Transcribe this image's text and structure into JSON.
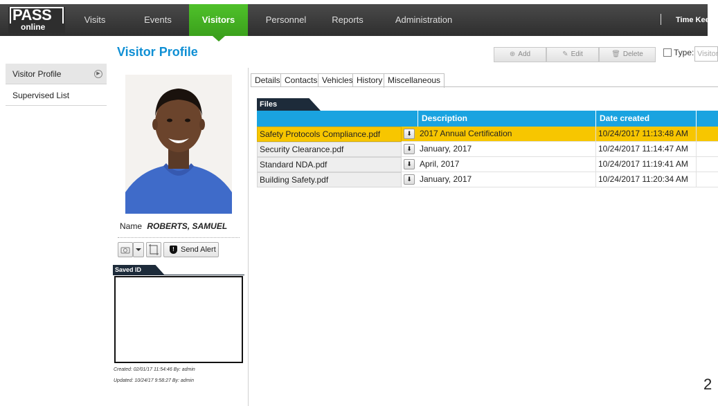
{
  "header": {
    "logo_main": "PASS",
    "logo_sub": "online",
    "nav": [
      "Visits",
      "Events",
      "Visitors",
      "Personnel",
      "Reports",
      "Administration"
    ],
    "active_nav": "Visitors",
    "right_item": "Time Keeping"
  },
  "sidebar": {
    "items": [
      {
        "label": "Visitor Profile"
      },
      {
        "label": "Supervised List"
      }
    ]
  },
  "page": {
    "title": "Visitor Profile"
  },
  "toolbar": {
    "add_label": "Add",
    "edit_label": "Edit",
    "delete_label": "Delete",
    "type_label": "Type:",
    "type_placeholder": "Visitor"
  },
  "profile": {
    "name_label": "Name",
    "name_value": "ROBERTS, SAMUEL",
    "send_alert": "Send Alert",
    "saved_id_label": "Saved ID",
    "created": "Created:  02/01/17 11:54:46  By: admin",
    "updated": "Updated:  10/24/17 9:58:27  By: admin"
  },
  "tabs": [
    "Details",
    "Contacts",
    "Vehicles",
    "History",
    "Miscellaneous"
  ],
  "active_tab": "Miscellaneous",
  "files": {
    "section_label": "Files",
    "columns": [
      "",
      "Description",
      "Date created"
    ],
    "rows": [
      {
        "file": "Safety Protocols Compliance.pdf",
        "description": "2017 Annual Certification",
        "date": "10/24/2017 11:13:48 AM",
        "selected": true
      },
      {
        "file": "Security Clearance.pdf",
        "description": "January, 2017",
        "date": "10/24/2017 11:14:47 AM",
        "selected": false
      },
      {
        "file": "Standard NDA.pdf",
        "description": "April, 2017",
        "date": "10/24/2017 11:19:41 AM",
        "selected": false
      },
      {
        "file": "Building Safety.pdf",
        "description": "January, 2017",
        "date": "10/24/2017 11:20:34 AM",
        "selected": false
      }
    ]
  },
  "page_number": "2",
  "colors": {
    "accent_blue": "#1aa3e0",
    "title_blue": "#0f8fd4",
    "nav_green": "#3ba11c",
    "selected_row": "#f7c600",
    "dark_tab": "#1d2b3a"
  },
  "icons": [
    "add-icon",
    "edit-icon",
    "delete-icon",
    "download-icon",
    "shield-alert-icon",
    "expand-icon",
    "capture-icon",
    "crop-icon"
  ]
}
